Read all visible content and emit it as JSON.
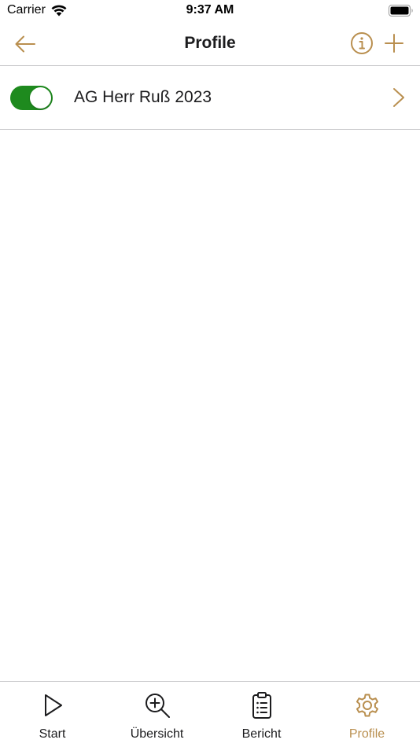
{
  "status_bar": {
    "carrier": "Carrier",
    "time": "9:37 AM"
  },
  "nav": {
    "title": "Profile",
    "back_icon": "arrow-left-icon",
    "info_icon": "info-circle-icon",
    "add_icon": "plus-icon"
  },
  "profiles": [
    {
      "name": "AG Herr Ruß 2023",
      "enabled": true
    }
  ],
  "tabs": [
    {
      "label": "Start",
      "icon": "play-icon",
      "active": false
    },
    {
      "label": "Übersicht",
      "icon": "zoom-in-icon",
      "active": false
    },
    {
      "label": "Bericht",
      "icon": "clipboard-list-icon",
      "active": false
    },
    {
      "label": "Profile",
      "icon": "gear-icon",
      "active": true
    }
  ],
  "colors": {
    "accent": "#b98f4f",
    "toggle_on": "#1e8a1e",
    "separator": "#c6c6c8",
    "text": "#1c1c1e"
  }
}
